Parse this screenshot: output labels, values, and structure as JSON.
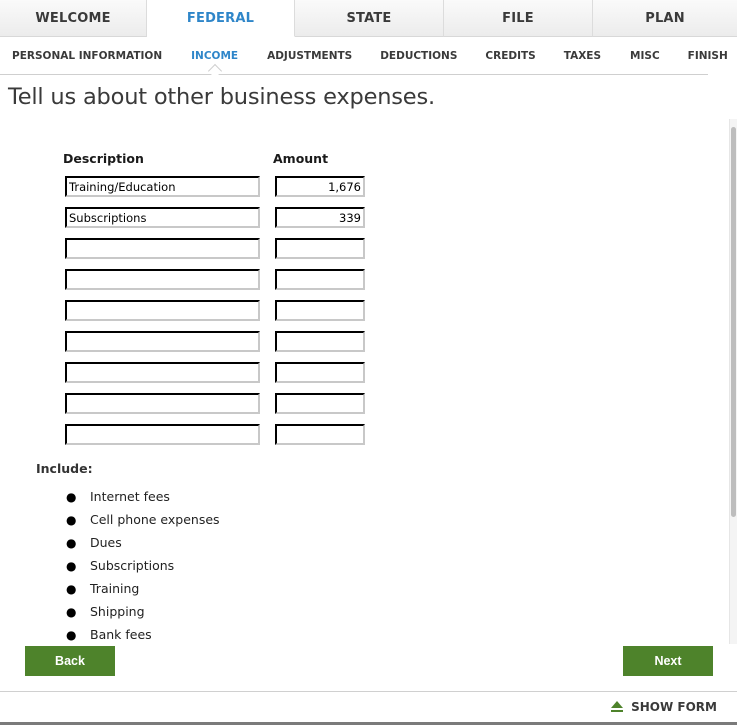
{
  "top_tabs": [
    {
      "label": "WELCOME",
      "active": false
    },
    {
      "label": "FEDERAL",
      "active": true
    },
    {
      "label": "STATE",
      "active": false
    },
    {
      "label": "FILE",
      "active": false
    },
    {
      "label": "PLAN",
      "active": false
    }
  ],
  "sub_nav": [
    {
      "label": "PERSONAL INFORMATION",
      "active": false
    },
    {
      "label": "INCOME",
      "active": true
    },
    {
      "label": "ADJUSTMENTS",
      "active": false
    },
    {
      "label": "DEDUCTIONS",
      "active": false
    },
    {
      "label": "CREDITS",
      "active": false
    },
    {
      "label": "TAXES",
      "active": false
    },
    {
      "label": "MISC",
      "active": false
    },
    {
      "label": "FINISH",
      "active": false
    }
  ],
  "page_title": "Tell us about other business expenses.",
  "table": {
    "description_header": "Description",
    "amount_header": "Amount",
    "rows": [
      {
        "description": "Training/Education",
        "amount": "1,676"
      },
      {
        "description": "Subscriptions",
        "amount": "339"
      },
      {
        "description": "",
        "amount": ""
      },
      {
        "description": "",
        "amount": ""
      },
      {
        "description": "",
        "amount": ""
      },
      {
        "description": "",
        "amount": ""
      },
      {
        "description": "",
        "amount": ""
      },
      {
        "description": "",
        "amount": ""
      },
      {
        "description": "",
        "amount": ""
      }
    ]
  },
  "include": {
    "label": "Include:",
    "items": [
      "Internet fees",
      "Cell phone expenses",
      "Dues",
      "Subscriptions",
      "Training",
      "Shipping",
      "Bank fees"
    ]
  },
  "buttons": {
    "back": "Back",
    "next": "Next"
  },
  "footer": {
    "show_form": "SHOW FORM",
    "icon": "eject-triangle-icon"
  },
  "colors": {
    "accent_blue": "#2f86c9",
    "button_green": "#4e832b"
  }
}
